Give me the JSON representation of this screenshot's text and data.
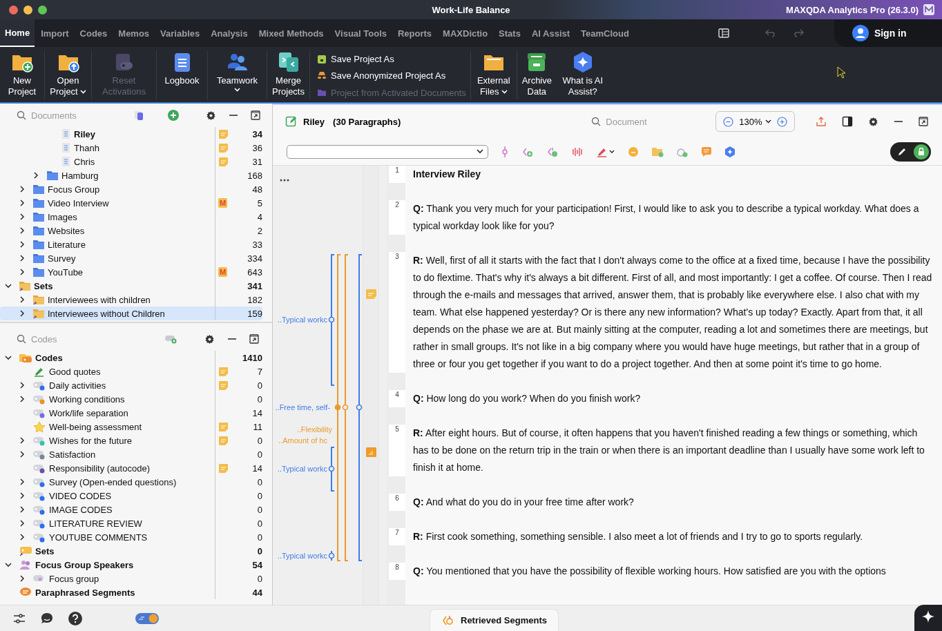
{
  "window": {
    "title": "Work-Life Balance",
    "app": "MAXQDA Analytics Pro (26.3.0)"
  },
  "menu_tabs": [
    {
      "label": "Home",
      "selected": true
    },
    {
      "label": "Import",
      "selected": false
    },
    {
      "label": "Codes",
      "selected": false
    },
    {
      "label": "Memos",
      "selected": false
    },
    {
      "label": "Variables",
      "selected": false
    },
    {
      "label": "Analysis",
      "selected": false
    },
    {
      "label": "Mixed Methods",
      "selected": false
    },
    {
      "label": "Visual Tools",
      "selected": false
    },
    {
      "label": "Reports",
      "selected": false
    },
    {
      "label": "MAXDictio",
      "selected": false
    },
    {
      "label": "Stats",
      "selected": false
    },
    {
      "label": "AI Assist",
      "selected": false
    },
    {
      "label": "TeamCloud",
      "selected": false
    }
  ],
  "sign_in": "Sign in",
  "ribbon": [
    {
      "kind": "button",
      "label": "New Project",
      "disabled": false,
      "dropdown": false
    },
    {
      "kind": "button",
      "label": "Open Project",
      "disabled": false,
      "dropdown": true
    },
    {
      "kind": "button",
      "label": "Reset Activations",
      "disabled": true,
      "dropdown": false
    },
    {
      "kind": "button",
      "label": "Logbook",
      "disabled": false,
      "dropdown": false
    },
    {
      "kind": "button",
      "label": "Teamwork",
      "disabled": false,
      "dropdown": true
    },
    {
      "kind": "button",
      "label": "Merge Projects",
      "disabled": false,
      "dropdown": false
    },
    {
      "kind": "list",
      "items": [
        {
          "label": "Save Project As",
          "disabled": false
        },
        {
          "label": "Save Anonymized Project As",
          "disabled": false
        },
        {
          "label": "Project from Activated Documents",
          "disabled": true
        }
      ]
    },
    {
      "kind": "button",
      "label": "External Files",
      "disabled": false,
      "dropdown": true
    },
    {
      "kind": "button",
      "label": "Archive Data",
      "disabled": false,
      "dropdown": false
    },
    {
      "kind": "button",
      "label": "What is AI Assist?",
      "disabled": false,
      "dropdown": false
    }
  ],
  "documents": {
    "placeholder": "Documents",
    "tree": [
      {
        "children": [
          {
            "children": [
              {
                "children": [
                  {
                    "label": "Riley",
                    "kind": "document",
                    "count": "34",
                    "open": true,
                    "memo": true,
                    "selected": false
                  },
                  {
                    "label": "Thanh",
                    "kind": "document",
                    "count": "36",
                    "open": false,
                    "memo": true,
                    "selected": false
                  },
                  {
                    "label": "Chris",
                    "kind": "document",
                    "count": "31",
                    "open": false,
                    "memo": true,
                    "selected": false
                  }
                ]
              },
              {
                "label": "Hamburg",
                "kind": "folder",
                "count": "168",
                "expanded": false,
                "memo": false,
                "selected": false
              }
            ]
          },
          {
            "label": "Focus Group",
            "kind": "folder",
            "count": "48",
            "expanded": false,
            "memo": false,
            "selected": false
          },
          {
            "label": "Video Interview",
            "kind": "folder",
            "count": "5",
            "expanded": false,
            "memo": false,
            "badge": "M",
            "selected": false
          },
          {
            "label": "Images",
            "kind": "folder",
            "count": "4",
            "expanded": false,
            "memo": false,
            "selected": false
          },
          {
            "label": "Websites",
            "kind": "folder",
            "count": "2",
            "expanded": false,
            "memo": false,
            "selected": false
          },
          {
            "label": "Literature",
            "kind": "folder",
            "count": "33",
            "expanded": false,
            "memo": false,
            "selected": false
          },
          {
            "label": "Survey",
            "kind": "folder",
            "count": "334",
            "expanded": false,
            "memo": false,
            "selected": false
          },
          {
            "label": "YouTube",
            "kind": "folder",
            "count": "643",
            "expanded": false,
            "memo": false,
            "badge": "M",
            "selected": false
          }
        ]
      },
      {
        "label": "Sets",
        "kind": "set-folder",
        "count": "341",
        "expanded": true,
        "memo": false,
        "selected": false,
        "children": [
          {
            "label": "Interviewees with children",
            "kind": "set-folder",
            "count": "182",
            "expanded": false,
            "memo": false,
            "selected": false
          },
          {
            "label": "Interviewees without Children",
            "kind": "set-folder",
            "count": "159",
            "expanded": false,
            "memo": false,
            "selected": true
          }
        ]
      }
    ]
  },
  "codes": {
    "placeholder": "Codes",
    "tree": [
      {
        "label": "Codes",
        "kind": "code-root",
        "count": "1410",
        "expanded": true,
        "memo": false,
        "selected": false,
        "children": [
          {
            "label": "Good quotes",
            "kind": "highlighter",
            "count": "7",
            "memo": true,
            "selected": false
          },
          {
            "label": "Daily activities",
            "kind": "code",
            "color": "#2f6fe8",
            "count": "0",
            "expanded": false,
            "memo": true,
            "selected": false
          },
          {
            "label": "Working conditions",
            "kind": "code",
            "color": "#f0901e",
            "count": "0",
            "expanded": false,
            "memo": false,
            "selected": false
          },
          {
            "label": "Work/life separation",
            "kind": "code",
            "color": "#7a6ae6",
            "count": "14",
            "memo": false,
            "selected": false
          },
          {
            "label": "Well-being assessment",
            "kind": "star",
            "count": "11",
            "memo": true,
            "selected": false
          },
          {
            "label": "Wishes for the future",
            "kind": "code",
            "color": "#3cbfb0",
            "count": "0",
            "expanded": false,
            "memo": true,
            "selected": false
          },
          {
            "label": "Satisfaction",
            "kind": "code",
            "color": "#7d8590",
            "count": "0",
            "expanded": false,
            "memo": false,
            "selected": false
          },
          {
            "label": "Responsibility (autocode)",
            "kind": "code",
            "color": "#6b4fae",
            "count": "14",
            "memo": true,
            "selected": false
          },
          {
            "label": "Survey (Open-ended questions)",
            "kind": "code",
            "color": "#2f6fe8",
            "count": "0",
            "expanded": false,
            "memo": false,
            "selected": false
          },
          {
            "label": "VIDEO CODES",
            "kind": "code",
            "color": "#2f6fe8",
            "count": "0",
            "expanded": false,
            "memo": false,
            "selected": false
          },
          {
            "label": "IMAGE CODES",
            "kind": "code",
            "color": "#2f6fe8",
            "count": "0",
            "expanded": false,
            "memo": false,
            "selected": false
          },
          {
            "label": "LITERATURE REVIEW",
            "kind": "code",
            "color": "#2f6fe8",
            "count": "0",
            "expanded": false,
            "memo": false,
            "selected": false
          },
          {
            "label": "YOUTUBE COMMENTS",
            "kind": "code",
            "color": "#2f6fe8",
            "count": "0",
            "expanded": false,
            "memo": false,
            "selected": false
          }
        ]
      },
      {
        "label": "Sets",
        "kind": "code-sets",
        "count": "0",
        "memo": false,
        "selected": false
      },
      {
        "label": "Focus Group Speakers",
        "kind": "speakers",
        "count": "54",
        "expanded": true,
        "memo": false,
        "selected": false,
        "children": [
          {
            "label": "Focus group",
            "kind": "speaker-code",
            "count": "0",
            "expanded": false,
            "memo": false,
            "selected": false
          }
        ]
      },
      {
        "label": "Paraphrased Segments",
        "kind": "paraphrase",
        "count": "44",
        "memo": false,
        "selected": false
      }
    ]
  },
  "document": {
    "name": "Riley",
    "info": "(30 Paragraphs)",
    "search_placeholder": "Document",
    "zoom": "130%",
    "locked": true,
    "coding_stripes": [
      {
        "label": "..Typical workc",
        "color": "#3f7be6"
      },
      {
        "label": "..Free time, self-",
        "color": "#3f7be6"
      },
      {
        "label": "..Flexibility",
        "color": "#eb9a2a"
      },
      {
        "label": "..Amount of hc",
        "color": "#eb9a2a"
      },
      {
        "label": "..Typical workc",
        "color": "#3f7be6"
      },
      {
        "label": "..Typical workc",
        "color": "#3f7be6"
      }
    ],
    "paragraphs": [
      {
        "number": "1",
        "kind": "title",
        "text": "Interview Riley"
      },
      {
        "number": "2",
        "kind": "body",
        "text": "**Q:** Thank you very much for your participation! First, I would like to ask you to describe a typical workday. What does a typical workday look like for you?"
      },
      {
        "number": "3",
        "kind": "body",
        "text": "**R:** Well, first of all it starts with the fact that I don't always come to the office at a fixed time, because I have the possibility to do flextime. That's why it's always a bit different. First of all, and most importantly: I get a coffee. Of course. Then I read through the e-mails and messages that arrived, answer them, that is probably like everywhere else. I also chat with my team. What else happened yesterday? Or is there any new information? What's up today? Exactly. Apart from that, it all depends on the phase we are at. But mainly sitting at the computer, reading a lot and sometimes there are meetings, but rather in small groups. It's not like in a big company where you would have huge meetings, but rather that in a group of three or four you get together if you want to do a project together. And then at some point it's time to go home."
      },
      {
        "number": "4",
        "kind": "body",
        "text": "**Q:** How long do you work? When do you finish work?"
      },
      {
        "number": "5",
        "kind": "body",
        "text": "**R:** After eight hours. But of course, it often happens that you haven't finished reading a few things or something, which has to be done on the return trip in the train or when there is an important deadline than I usually have some work left to finish it at home."
      },
      {
        "number": "6",
        "kind": "body",
        "text": "**Q:** And what do you do in your free time after work?"
      },
      {
        "number": "7",
        "kind": "body",
        "text": "**R:** First cook something, something sensible. I also meet a lot of friends and I try to go to sports regularly."
      },
      {
        "number": "8",
        "kind": "body",
        "text": "**Q:** You mentioned that you have the possibility of flexible working hours. How satisfied are you with the options"
      }
    ]
  },
  "bottom_bar": {
    "tab": "Retrieved Segments"
  }
}
